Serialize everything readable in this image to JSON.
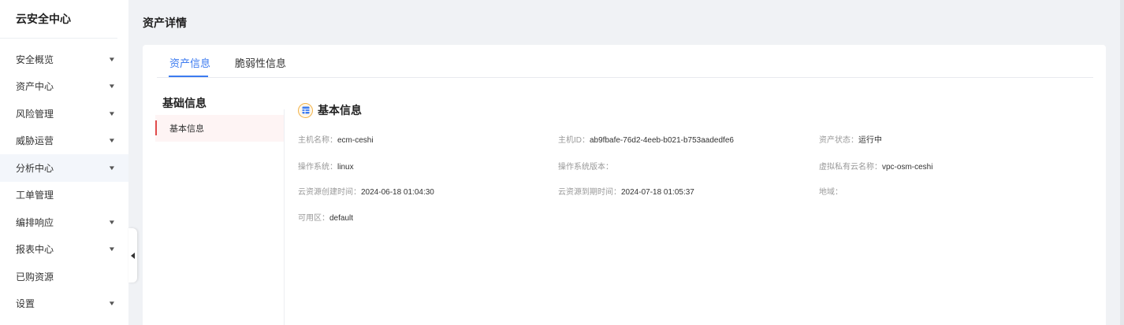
{
  "sidebar": {
    "brand": "云安全中心",
    "items": [
      {
        "label": "安全概览",
        "has_caret": true
      },
      {
        "label": "资产中心",
        "has_caret": true
      },
      {
        "label": "风险管理",
        "has_caret": true
      },
      {
        "label": "威胁运营",
        "has_caret": true
      },
      {
        "label": "分析中心",
        "has_caret": true,
        "active": true
      },
      {
        "label": "工单管理",
        "has_caret": false
      },
      {
        "label": "编排响应",
        "has_caret": true
      },
      {
        "label": "报表中心",
        "has_caret": true
      },
      {
        "label": "已购资源",
        "has_caret": false
      },
      {
        "label": "设置",
        "has_caret": true
      }
    ],
    "caret_glyph": "▼"
  },
  "header": {
    "title": "资产详情"
  },
  "tabs": [
    {
      "label": "资产信息",
      "active": true
    },
    {
      "label": "脆弱性信息",
      "active": false
    }
  ],
  "side_nav": {
    "title": "基础信息",
    "items": [
      {
        "label": "基本信息"
      }
    ]
  },
  "section": {
    "title": "基本信息",
    "icon": "table-icon",
    "fields": [
      {
        "label": "主机名称：",
        "value": "ecm-ceshi"
      },
      {
        "label": "主机ID：",
        "value": "ab9fbafe-76d2-4eeb-b021-b753aadedfe6"
      },
      {
        "label": "资产状态：",
        "value": "运行中"
      },
      {
        "label": "操作系统：",
        "value": "linux"
      },
      {
        "label": "操作系统版本：",
        "value": ""
      },
      {
        "label": "虚拟私有云名称：",
        "value": "vpc-osm-ceshi"
      },
      {
        "label": "云资源创建时间：",
        "value": "2024-06-18 01:04:30"
      },
      {
        "label": "云资源到期时间：",
        "value": "2024-07-18 01:05:37"
      },
      {
        "label": "地域：",
        "value": ""
      },
      {
        "label": "可用区：",
        "value": "default"
      }
    ]
  },
  "colors": {
    "accent": "#3c7bf0",
    "side_marker": "#e04b4b",
    "section_icon": "#f2b34b",
    "page_bg": "#f0f2f5"
  }
}
